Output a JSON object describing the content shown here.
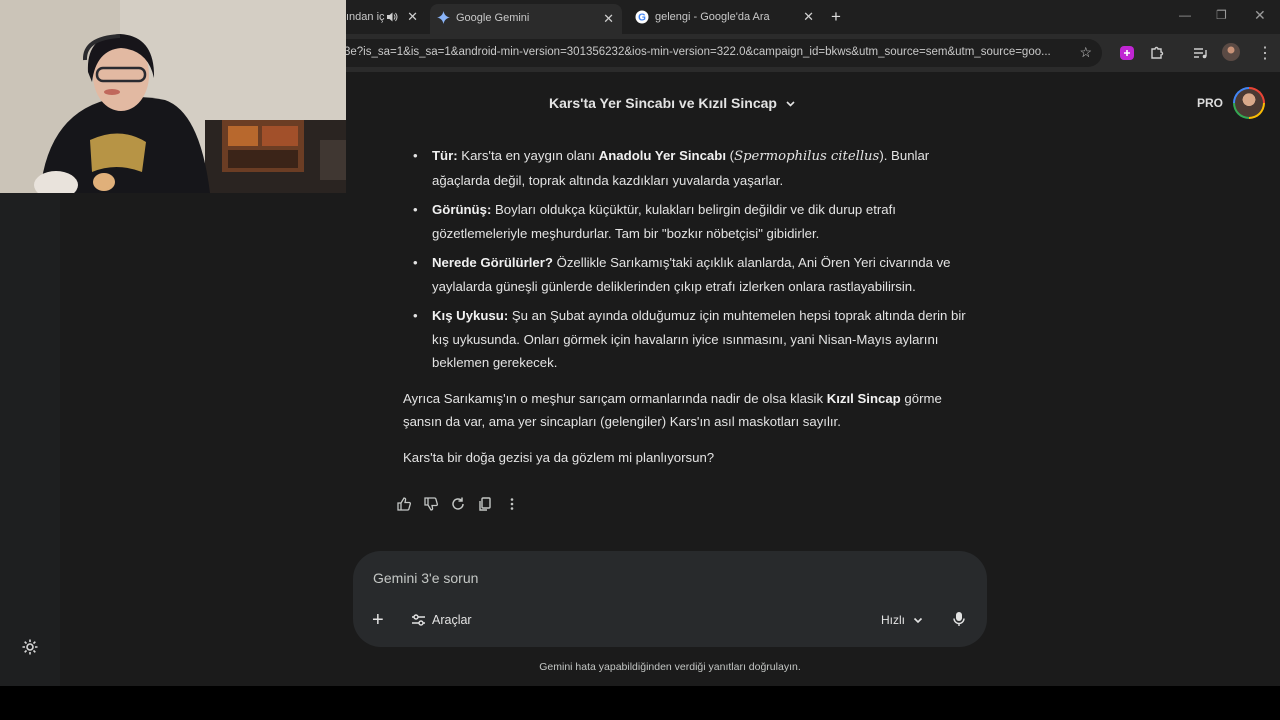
{
  "browser": {
    "tabs": [
      {
        "title": "ından iç",
        "active": false,
        "audio": true
      },
      {
        "title": "Google Gemini",
        "active": true
      },
      {
        "title": "gelengi - Google'da Ara",
        "active": false
      }
    ],
    "url": "3e?is_sa=1&is_sa=1&android-min-version=301356232&ios-min-version=322.0&campaign_id=bkws&utm_source=sem&utm_source=goo..."
  },
  "header": {
    "conversation_title": "Kars'ta Yer Sincabı ve Kızıl Sincap",
    "badge": "PRO"
  },
  "response": {
    "bullets": [
      {
        "term": "Tür:",
        "pre": " Kars'ta en yaygın olanı ",
        "bold": "Anadolu Yer Sincabı",
        "latin": "Spermophilus citellus",
        "post": ". Bunlar ağaçlarda değil, toprak altında kazdıkları yuvalarda yaşarlar."
      },
      {
        "term": "Görünüş:",
        "text": " Boyları oldukça küçüktür, kulakları belirgin değildir ve dik durup etrafı gözetlemeleriyle meşhurdurlar. Tam bir \"bozkır nöbetçisi\" gibidirler."
      },
      {
        "term": "Nerede Görülürler?",
        "text": " Özellikle Sarıkamış'taki açıklık alanlarda, Ani Ören Yeri civarında ve yaylalarda güneşli günlerde deliklerinden çıkıp etrafı izlerken onlara rastlayabilirsin."
      },
      {
        "term": "Kış Uykusu:",
        "text": " Şu an Şubat ayında olduğumuz için muhtemelen hepsi toprak altında derin bir kış uykusunda. Onları görmek için havaların iyice ısınmasını, yani Nisan-Mayıs aylarını beklemen gerekecek."
      }
    ],
    "para1_pre": "Ayrıca Sarıkamış'ın o meşhur sarıçam ormanlarında nadir de olsa klasik ",
    "para1_bold": "Kızıl Sincap",
    "para1_post": " görme şansın da var, ama yer sincapları (gelengiler) Kars'ın asıl maskotları sayılır.",
    "para2": "Kars'ta bir doğa gezisi ya da gözlem mi planlıyorsun?"
  },
  "prompt": {
    "placeholder": "Gemini 3'e sorun",
    "tools_label": "Araçlar",
    "speed_label": "Hızlı"
  },
  "footer": {
    "disclaimer": "Gemini hata yapabildiğinden verdiği yanıtları doğrulayın."
  }
}
